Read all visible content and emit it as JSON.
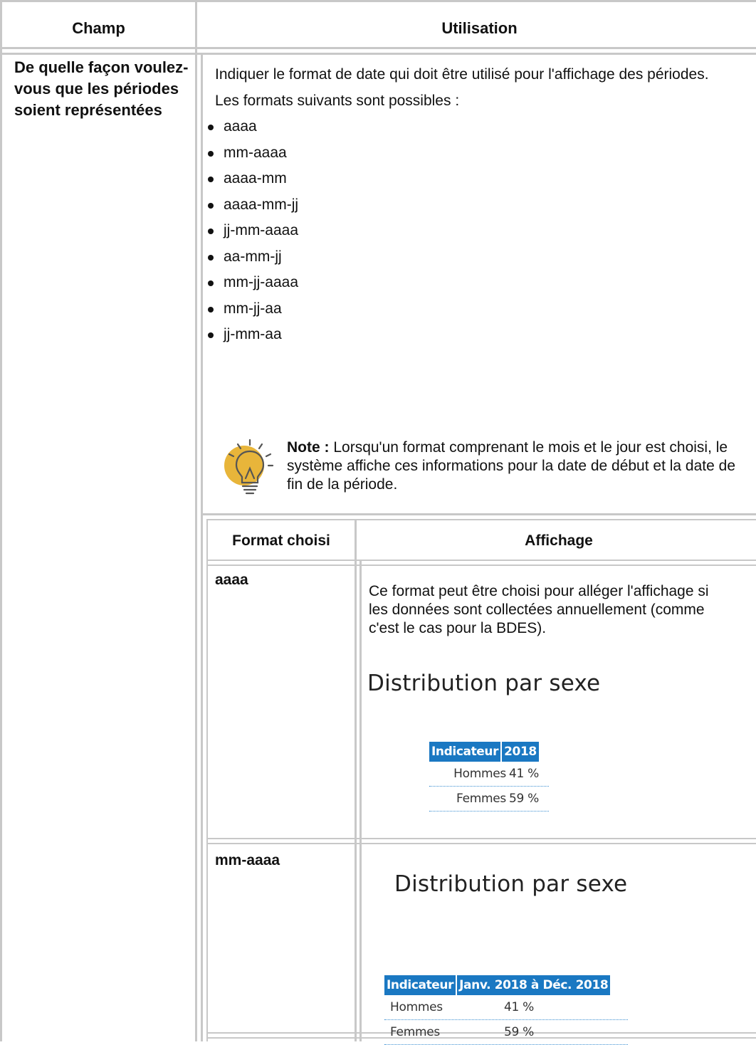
{
  "table": {
    "headers": {
      "field": "Champ",
      "usage": "Utilisation"
    },
    "field_name": "De quelle façon voulez-vous que les périodes soient représentées",
    "usage": {
      "intro": "Indiquer le format de date qui doit être utilisé pour l'affichage des périodes.",
      "formats_intro": "Les formats suivants sont possibles :",
      "formats": [
        "aaaa",
        "mm-aaaa",
        "aaaa-mm",
        "aaaa-mm-jj",
        "jj-mm-aaaa",
        "aa-mm-jj",
        "mm-jj-aaaa",
        "mm-jj-aa",
        "jj-mm-aa"
      ],
      "note": {
        "icon": "lightbulb-icon",
        "label": "Note :",
        "text": "Lorsqu'un format comprenant le mois et le jour est choisi, le système affiche ces informations pour la date de début et la date de fin de la période."
      }
    }
  },
  "examples": {
    "headers": {
      "format": "Format choisi",
      "display": "Affichage"
    },
    "rows": [
      {
        "format": "aaaa",
        "description": "Ce format peut être choisi pour alléger l'affichage si les données sont collectées annuellement (comme c'est le cas pour la BDES).",
        "screenshot": {
          "title": "Distribution par sexe",
          "columns": [
            "Indicateur",
            "2018"
          ],
          "rows": [
            [
              "Hommes",
              "41 %"
            ],
            [
              "Femmes",
              "59 %"
            ]
          ]
        }
      },
      {
        "format": "mm-aaaa",
        "description": "",
        "screenshot": {
          "title": "Distribution par sexe",
          "columns": [
            "Indicateur",
            "Janv. 2018 à Déc. 2018"
          ],
          "rows": [
            [
              "Hommes",
              "41 %"
            ],
            [
              "Femmes",
              "59 %"
            ]
          ]
        }
      }
    ]
  },
  "colors": {
    "border": "#c8c8c8",
    "mini_header_bg": "#1a78c2",
    "bulb_accent": "#e8b53a"
  }
}
